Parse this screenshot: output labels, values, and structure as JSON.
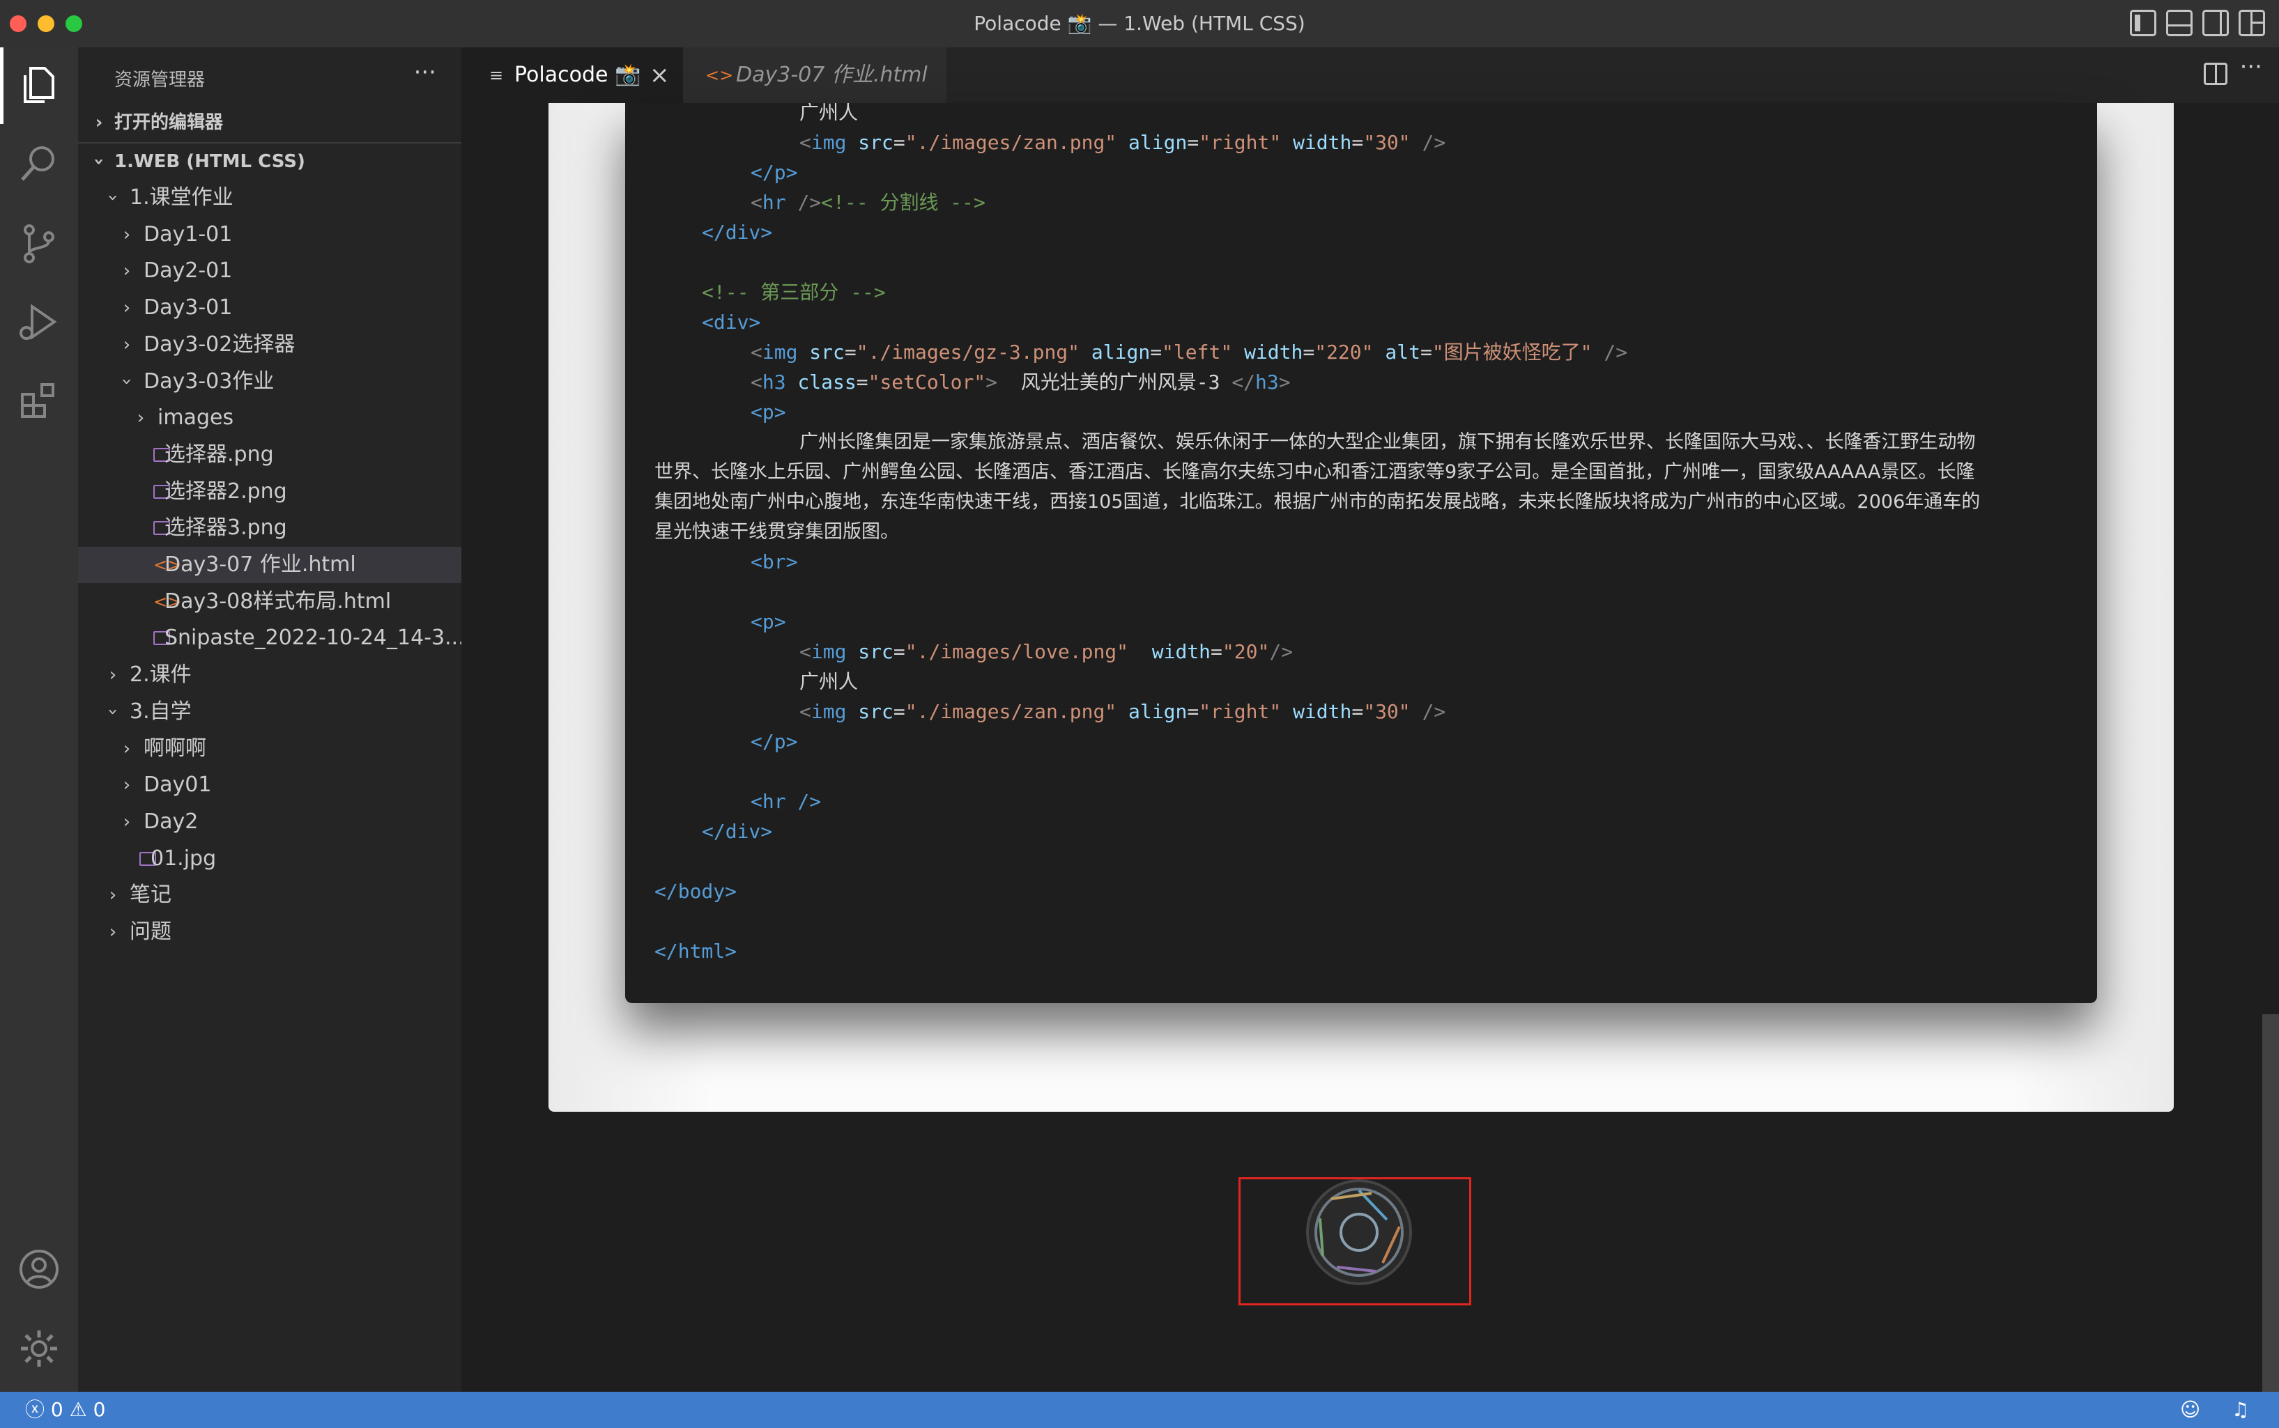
{
  "window": {
    "title": "Polacode 📸 — 1.Web (HTML CSS)"
  },
  "sidebar": {
    "title": "资源管理器",
    "more": "···",
    "open_editors": "打开的编辑器",
    "workspace": "1.WEB (HTML CSS)",
    "tree": [
      {
        "label": "1.课堂作业",
        "kind": "folder",
        "open": true
      },
      {
        "label": "Day1-01",
        "kind": "folder",
        "open": false
      },
      {
        "label": "Day2-01",
        "kind": "folder",
        "open": false
      },
      {
        "label": "Day3-01",
        "kind": "folder",
        "open": false
      },
      {
        "label": "Day3-02选择器",
        "kind": "folder",
        "open": false
      },
      {
        "label": "Day3-03作业",
        "kind": "folder",
        "open": true
      },
      {
        "label": "images",
        "kind": "folder",
        "open": false
      },
      {
        "label": "选择器.png",
        "kind": "image"
      },
      {
        "label": "选择器2.png",
        "kind": "image"
      },
      {
        "label": "选择器3.png",
        "kind": "image"
      },
      {
        "label": "Day3-07 作业.html",
        "kind": "html",
        "selected": true
      },
      {
        "label": "Day3-08样式布局.html",
        "kind": "html"
      },
      {
        "label": "Snipaste_2022-10-24_14-3...",
        "kind": "image"
      },
      {
        "label": "2.课件",
        "kind": "folder",
        "open": false
      },
      {
        "label": "3.自学",
        "kind": "folder",
        "open": true
      },
      {
        "label": "啊啊啊",
        "kind": "folder",
        "open": false
      },
      {
        "label": "Day01",
        "kind": "folder",
        "open": false
      },
      {
        "label": "Day2",
        "kind": "folder",
        "open": false
      },
      {
        "label": "01.jpg",
        "kind": "image"
      },
      {
        "label": "笔记",
        "kind": "folder",
        "open": false
      },
      {
        "label": "问题",
        "kind": "folder",
        "open": false
      }
    ]
  },
  "tabs": [
    {
      "label": "Polacode 📸",
      "close": "×",
      "icon": "preview-icon",
      "active": true
    },
    {
      "label": "Day3-07 作业.html",
      "icon": "html-icon",
      "active": false
    }
  ],
  "code": {
    "l01": "广州人",
    "l02": {
      "tag": "img",
      "src_attr": "src",
      "src_val": "\"./images/zan.png\"",
      "align_attr": "align",
      "align_val": "\"right\"",
      "width_attr": "width",
      "width_val": "\"30\""
    },
    "l03": "</p>",
    "l04": {
      "tag": "hr",
      "comment": "<!-- 分割线 -->"
    },
    "l05": "</div>",
    "l07": "<!-- 第三部分 -->",
    "l08": "<div>",
    "l09": {
      "src_val": "\"./images/gz-3.png\"",
      "align_val": "\"left\"",
      "width_val": "\"220\"",
      "alt_attr": "alt",
      "alt_val": "\"图片被妖怪吃了\""
    },
    "l10": {
      "class_attr": "class",
      "class_val": "\"setColor\"",
      "text": "风光壮美的广州风景-3"
    },
    "l11": "<p>",
    "para1": "广州长隆集团是一家集旅游景点、酒店餐饮、娱乐休闲于一体的大型企业集团，旗下拥有长隆欢乐世界、长隆国际大马戏、、长隆香江野生动物",
    "para2": "世界、长隆水上乐园、广州鳄鱼公园、长隆酒店、香江酒店、长隆高尔夫练习中心和香江酒家等9家子公司。是全国首批，广州唯一，国家级AAAAA景区。长隆",
    "para3": "集团地处南广州中心腹地，东连华南快速干线，西接105国道，北临珠江。根据广州市的南拓发展战略，未来长隆版块将成为广州市的中心区域。2006年通车的",
    "para4": "星光快速干线贯穿集团版图。",
    "l16": "<br>",
    "l18": "<p>",
    "l19": {
      "src_val": "\"./images/love.png\"",
      "width_val": "\"20\""
    },
    "l20": "广州人",
    "l21": {
      "src_val": "\"./images/zan.png\"",
      "align_val": "\"right\"",
      "width_val": "\"30\""
    },
    "l22": "</p>",
    "l24": "<hr />",
    "l25": "</div>",
    "l27": "</body>",
    "l29": "</html>"
  },
  "statusbar": {
    "errors": "0",
    "warnings": "0"
  },
  "colors": {
    "accent_status": "#3f7ccc",
    "selection_box": "#e0261e",
    "tag": "#569cd6",
    "attr": "#9cdcfe",
    "string": "#ce9178",
    "comment": "#6a9955"
  }
}
